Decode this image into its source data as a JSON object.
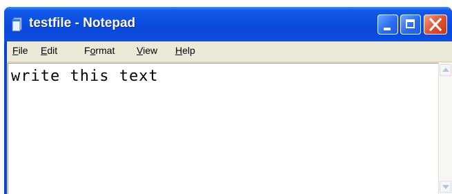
{
  "window": {
    "title": "testfile - Notepad",
    "icon": "notepad-icon",
    "controls": {
      "minimize_icon": "minimize-icon",
      "maximize_icon": "maximize-icon",
      "close_icon": "close-icon"
    }
  },
  "menu": {
    "items": [
      {
        "pre": "",
        "key": "F",
        "post": "ile"
      },
      {
        "pre": "",
        "key": "E",
        "post": "dit"
      },
      {
        "pre": "F",
        "key": "o",
        "post": "rmat"
      },
      {
        "pre": "",
        "key": "V",
        "post": "iew"
      },
      {
        "pre": "",
        "key": "H",
        "post": "elp"
      }
    ]
  },
  "editor": {
    "text": "write this text"
  },
  "scrollbar": {
    "up_icon": "scroll-up-arrow-icon",
    "down_icon": "scroll-down-arrow-icon"
  },
  "colors": {
    "titlebar": "#0c4fe0",
    "close_button": "#e0532e",
    "face": "#ece9d8"
  }
}
